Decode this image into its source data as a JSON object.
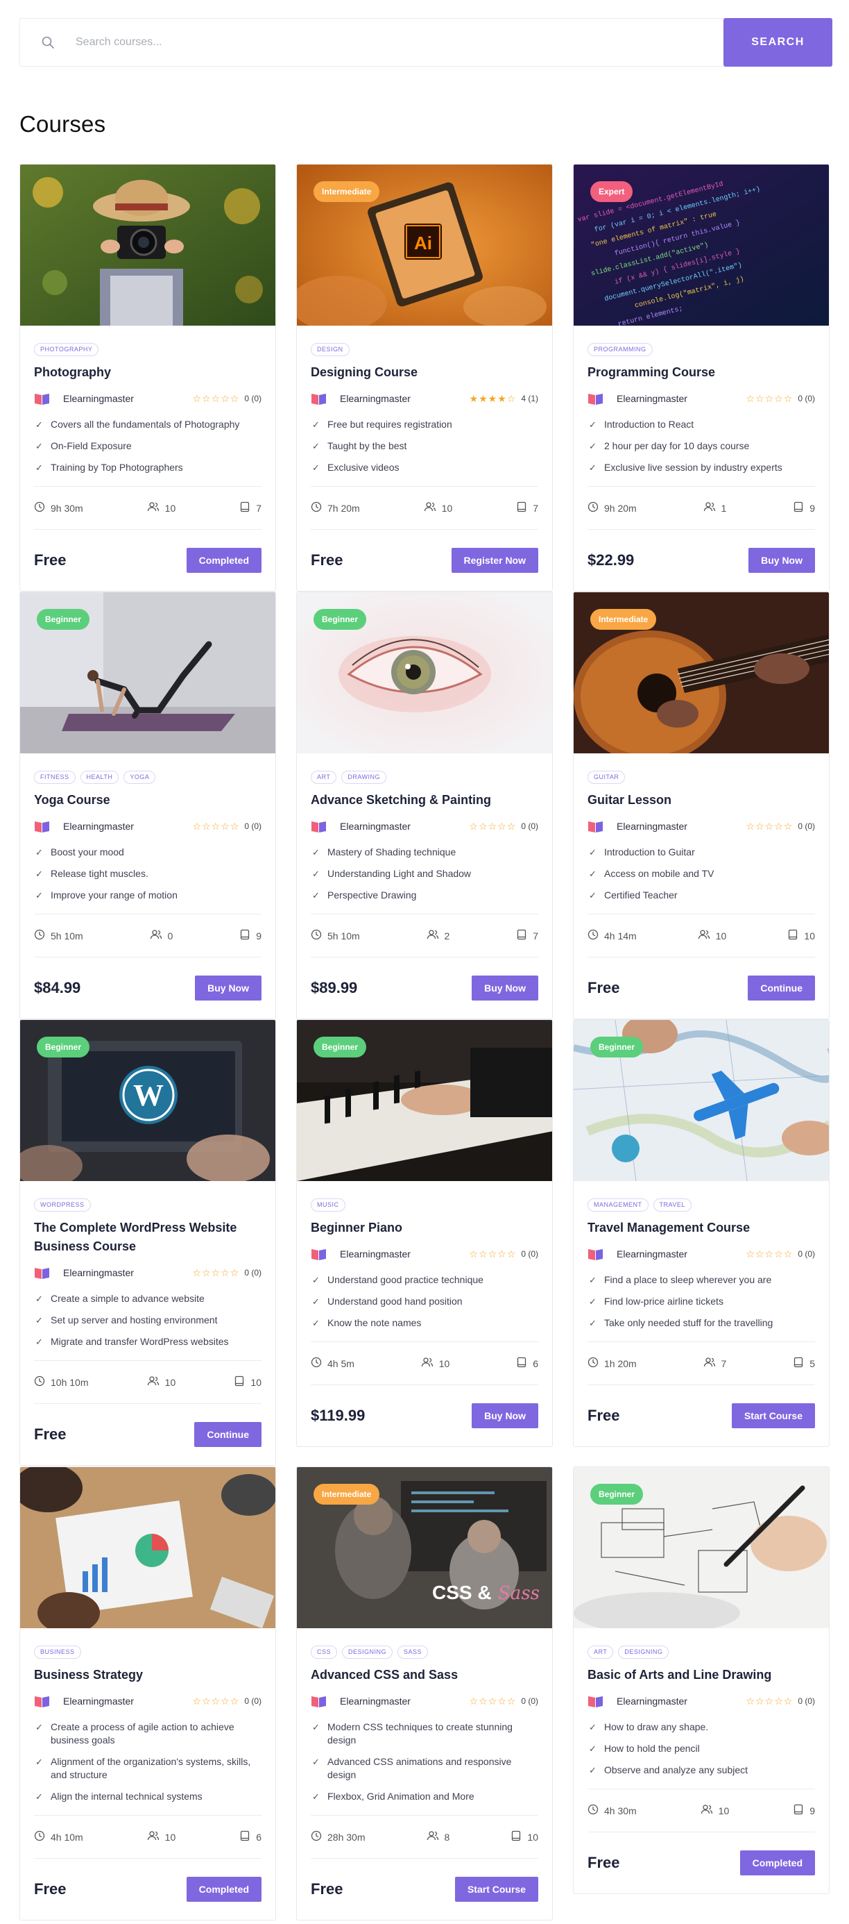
{
  "search": {
    "placeholder": "Search courses...",
    "button": "SEARCH"
  },
  "page_title": "Courses",
  "colors": {
    "accent": "#7f67e0",
    "beginner": "#5bcf7b",
    "intermediate": "#f8a744",
    "expert": "#f2607e",
    "star": "#f5a623"
  },
  "courses": [
    {
      "image": "photographer-with-camera",
      "level": "",
      "tags": [
        "PHOTOGRAPHY"
      ],
      "title": "Photography",
      "author": "Elearningmaster",
      "stars": 0,
      "rating": "0 (0)",
      "features": [
        "Covers all the fundamentals of Photography",
        "On-Field Exposure",
        "Training by Top Photographers"
      ],
      "duration": "9h 30m",
      "students": "10",
      "lessons": "7",
      "price": "Free",
      "button": "Completed"
    },
    {
      "image": "adobe-illustrator-tablet",
      "level": "Intermediate",
      "tags": [
        "DESIGN"
      ],
      "title": "Designing Course",
      "author": "Elearningmaster",
      "stars": 4,
      "rating": "4 (1)",
      "features": [
        "Free but requires registration",
        "Taught by the best",
        "Exclusive videos"
      ],
      "duration": "7h 20m",
      "students": "10",
      "lessons": "7",
      "price": "Free",
      "button": "Register Now"
    },
    {
      "image": "code-screen",
      "level": "Expert",
      "tags": [
        "PROGRAMMING"
      ],
      "title": "Programming Course",
      "author": "Elearningmaster",
      "stars": 0,
      "rating": "0 (0)",
      "features": [
        "Introduction to React",
        "2 hour per day for 10 days course",
        "Exclusive live session by industry experts"
      ],
      "duration": "9h 20m",
      "students": "1",
      "lessons": "9",
      "price": "$22.99",
      "button": "Buy Now"
    },
    {
      "image": "yoga-pose",
      "level": "Beginner",
      "tags": [
        "FITNESS",
        "HEALTH",
        "YOGA"
      ],
      "title": "Yoga Course",
      "author": "Elearningmaster",
      "stars": 0,
      "rating": "0 (0)",
      "features": [
        "Boost your mood",
        "Release tight muscles.",
        "Improve your range of motion"
      ],
      "duration": "5h 10m",
      "students": "0",
      "lessons": "9",
      "price": "$84.99",
      "button": "Buy Now"
    },
    {
      "image": "eye-sketch",
      "level": "Beginner",
      "tags": [
        "ART",
        "DRAWING"
      ],
      "title": "Advance Sketching & Painting",
      "author": "Elearningmaster",
      "stars": 0,
      "rating": "0 (0)",
      "features": [
        "Mastery of Shading technique",
        "Understanding Light and Shadow",
        "Perspective Drawing"
      ],
      "duration": "5h 10m",
      "students": "2",
      "lessons": "7",
      "price": "$89.99",
      "button": "Buy Now"
    },
    {
      "image": "acoustic-guitar",
      "level": "Intermediate",
      "tags": [
        "GUITAR"
      ],
      "title": "Guitar Lesson",
      "author": "Elearningmaster",
      "stars": 0,
      "rating": "0 (0)",
      "features": [
        "Introduction to Guitar",
        "Access on mobile and TV",
        "Certified Teacher"
      ],
      "duration": "4h 14m",
      "students": "10",
      "lessons": "10",
      "price": "Free",
      "button": "Continue"
    },
    {
      "image": "wordpress-laptop",
      "level": "Beginner",
      "tags": [
        "WORDPRESS"
      ],
      "title": "The Complete WordPress Website Business Course",
      "author": "Elearningmaster",
      "stars": 0,
      "rating": "0 (0)",
      "features": [
        "Create a simple to advance website",
        "Set up server and hosting environment",
        "Migrate and transfer WordPress websites"
      ],
      "duration": "10h 10m",
      "students": "10",
      "lessons": "10",
      "price": "Free",
      "button": "Continue"
    },
    {
      "image": "piano-hands",
      "level": "Beginner",
      "tags": [
        "MUSIC"
      ],
      "title": "Beginner Piano",
      "author": "Elearningmaster",
      "stars": 0,
      "rating": "0 (0)",
      "features": [
        "Understand good practice technique",
        "Understand good hand position",
        "Know the note names"
      ],
      "duration": "4h 5m",
      "students": "10",
      "lessons": "6",
      "price": "$119.99",
      "button": "Buy Now"
    },
    {
      "image": "travel-map-airplane",
      "level": "Beginner",
      "tags": [
        "MANAGEMENT",
        "TRAVEL"
      ],
      "title": "Travel Management Course",
      "author": "Elearningmaster",
      "stars": 0,
      "rating": "0 (0)",
      "features": [
        "Find a place to sleep wherever you are",
        "Find low-price airline tickets",
        "Take only needed stuff for the travelling"
      ],
      "duration": "1h 20m",
      "students": "7",
      "lessons": "5",
      "price": "Free",
      "button": "Start Course"
    },
    {
      "image": "business-meeting-charts",
      "level": "",
      "tags": [
        "BUSINESS"
      ],
      "title": "Business Strategy",
      "author": "Elearningmaster",
      "stars": 0,
      "rating": "0 (0)",
      "features": [
        "Create a process of agile action to achieve business goals",
        "Alignment of the organization's systems, skills, and structure",
        "Align the internal technical systems"
      ],
      "duration": "4h 10m",
      "students": "10",
      "lessons": "6",
      "price": "Free",
      "button": "Completed"
    },
    {
      "image": "css-sass-students",
      "level": "Intermediate",
      "tags": [
        "CSS",
        "DESIGNING",
        "SASS"
      ],
      "title": "Advanced CSS and Sass",
      "author": "Elearningmaster",
      "stars": 0,
      "rating": "0 (0)",
      "features": [
        "Modern CSS techniques to create stunning design",
        "Advanced CSS animations and responsive design",
        "Flexbox, Grid Animation and More"
      ],
      "duration": "28h 30m",
      "students": "8",
      "lessons": "10",
      "price": "Free",
      "button": "Start Course"
    },
    {
      "image": "line-drawing-hand",
      "level": "Beginner",
      "tags": [
        "ART",
        "DESIGNING"
      ],
      "title": "Basic of Arts and Line Drawing",
      "author": "Elearningmaster",
      "stars": 0,
      "rating": "0 (0)",
      "features": [
        "How to draw any shape.",
        "How to hold the pencil",
        "Observe and analyze any subject"
      ],
      "duration": "4h 30m",
      "students": "10",
      "lessons": "9",
      "price": "Free",
      "button": "Completed"
    }
  ]
}
